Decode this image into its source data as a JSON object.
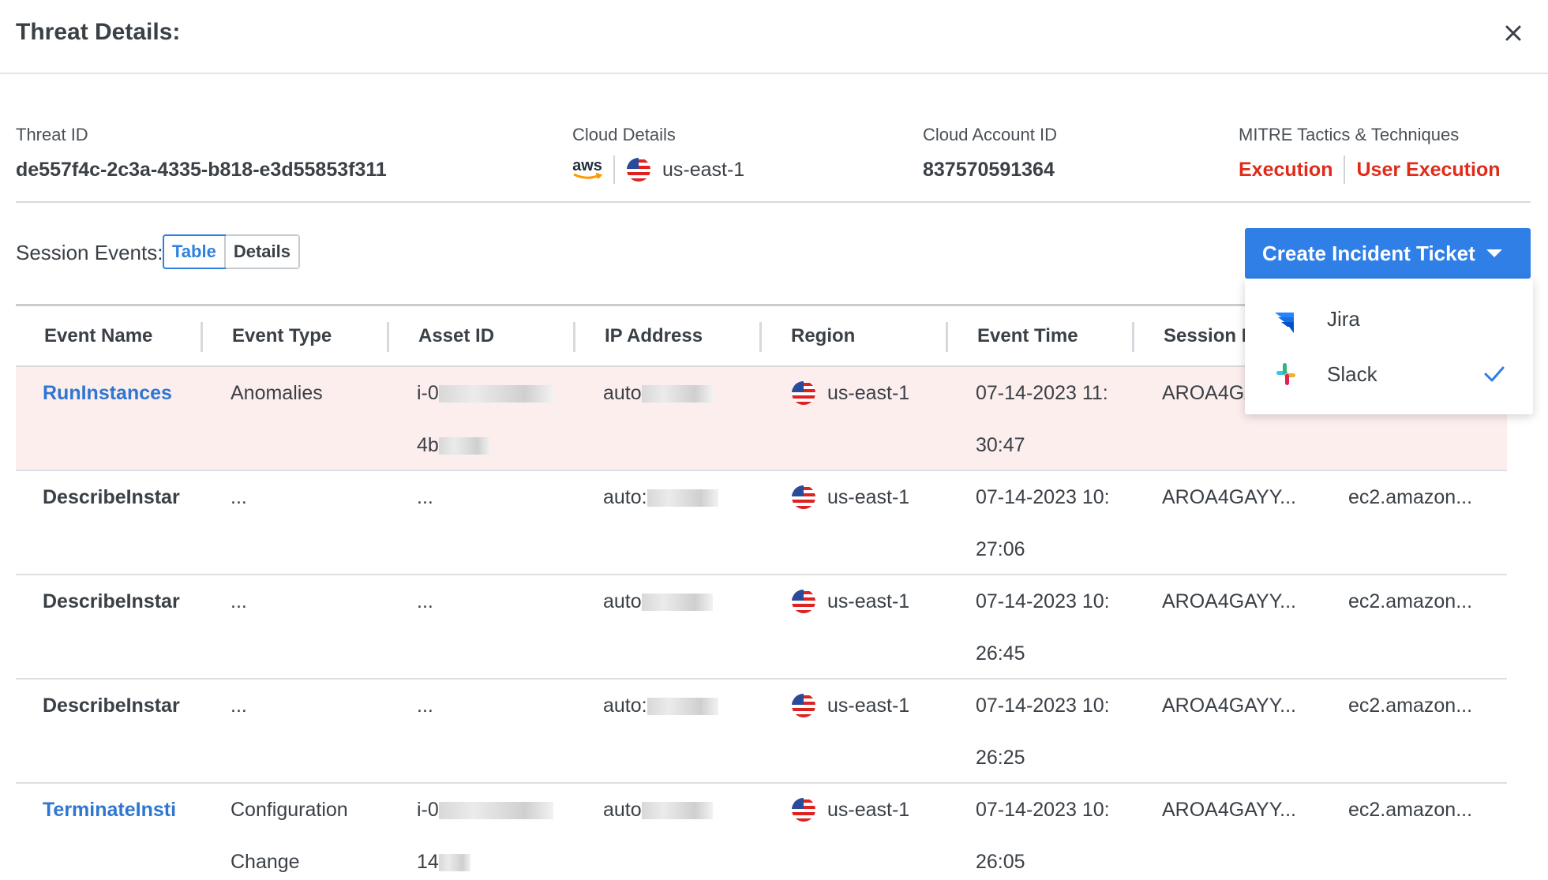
{
  "header": {
    "title": "Threat Details:",
    "close_icon": "close-icon"
  },
  "threat": {
    "threat_id_label": "Threat ID",
    "threat_id": "de557f4c-2c3a-4335-b818-e3d55853f311",
    "cloud_label": "Cloud Details",
    "cloud_provider": "aws",
    "cloud_region": "us-east-1",
    "account_label": "Cloud Account ID",
    "account_id": "837570591364",
    "mitre_label": "MITRE Tactics & Techniques",
    "mitre_tactic": "Execution",
    "mitre_technique": "User Execution"
  },
  "session": {
    "label": "Session Events:",
    "tab_table": "Table",
    "tab_details": "Details",
    "active_tab": "Table"
  },
  "ticket": {
    "button_label": "Create Incident Ticket",
    "options": [
      {
        "label": "Jira",
        "icon": "jira-icon",
        "selected": false
      },
      {
        "label": "Slack",
        "icon": "slack-icon",
        "selected": true
      }
    ]
  },
  "table": {
    "columns": [
      "Event Name",
      "Event Type",
      "Asset ID",
      "IP Address",
      "Region",
      "Event Time",
      "Session I"
    ],
    "rows": [
      {
        "name": "RunInstances",
        "type1": "Anomalies",
        "type2": "",
        "asset1": "i-0",
        "asset2": "4b",
        "ip": "auto",
        "region": "us-east-1",
        "time1": "07-14-2023 11:",
        "time2": "30:47",
        "session": "AROA4GA",
        "source": "",
        "link": true,
        "highlight": true
      },
      {
        "name": "DescribeInstar",
        "type1": "...",
        "type2": "",
        "asset1": "...",
        "asset2": "",
        "ip": "auto:",
        "region": "us-east-1",
        "time1": "07-14-2023 10:",
        "time2": "27:06",
        "session": "AROA4GAYY...",
        "source": "ec2.amazon...",
        "link": false,
        "highlight": false
      },
      {
        "name": "DescribeInstar",
        "type1": "...",
        "type2": "",
        "asset1": "...",
        "asset2": "",
        "ip": "auto",
        "region": "us-east-1",
        "time1": "07-14-2023 10:",
        "time2": "26:45",
        "session": "AROA4GAYY...",
        "source": "ec2.amazon...",
        "link": false,
        "highlight": false
      },
      {
        "name": "DescribeInstar",
        "type1": "...",
        "type2": "",
        "asset1": "...",
        "asset2": "",
        "ip": "auto:",
        "region": "us-east-1",
        "time1": "07-14-2023 10:",
        "time2": "26:25",
        "session": "AROA4GAYY...",
        "source": "ec2.amazon...",
        "link": false,
        "highlight": false
      },
      {
        "name": "TerminateInsti",
        "type1": "Configuration",
        "type2": "Change",
        "asset1": "i-0",
        "asset2": "14",
        "ip": "auto",
        "region": "us-east-1",
        "time1": "07-14-2023 10:",
        "time2": "26:05",
        "session": "AROA4GAYY...",
        "source": "ec2.amazon...",
        "link": true,
        "highlight": false
      }
    ]
  },
  "colors": {
    "accent": "#2f7fe6",
    "link": "#2f76d2",
    "mitre": "#e02b1a",
    "highlight_row": "#fdeeee"
  }
}
